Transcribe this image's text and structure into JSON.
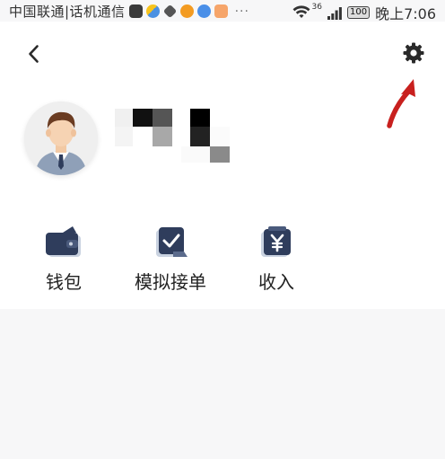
{
  "status_bar": {
    "carrier": "中国联通|话机通信",
    "app_icons": [
      "voip-app-icon",
      "multicolor-app-icon",
      "hex-app-icon",
      "orange-app-icon",
      "blue-app-icon",
      "peach-app-icon"
    ],
    "more": "···",
    "network_label": "36",
    "battery": "100",
    "time": "晚上7:06"
  },
  "header": {
    "back_icon": "chevron-left-icon",
    "settings_icon": "gear-icon",
    "annotation": "red-arrow-pointing-to-settings"
  },
  "profile": {
    "avatar": "businessman-avatar",
    "username_redacted": true
  },
  "actions": [
    {
      "label": "钱包",
      "icon": "wallet-icon"
    },
    {
      "label": "模拟接单",
      "icon": "mock-order-icon"
    },
    {
      "label": "收入",
      "icon": "income-yen-icon"
    }
  ],
  "colors": {
    "accent_navy": "#2f3d5c",
    "annotation_red": "#c8201e",
    "page_bg": "#f7f7f8",
    "header_bg": "#ffffff"
  }
}
